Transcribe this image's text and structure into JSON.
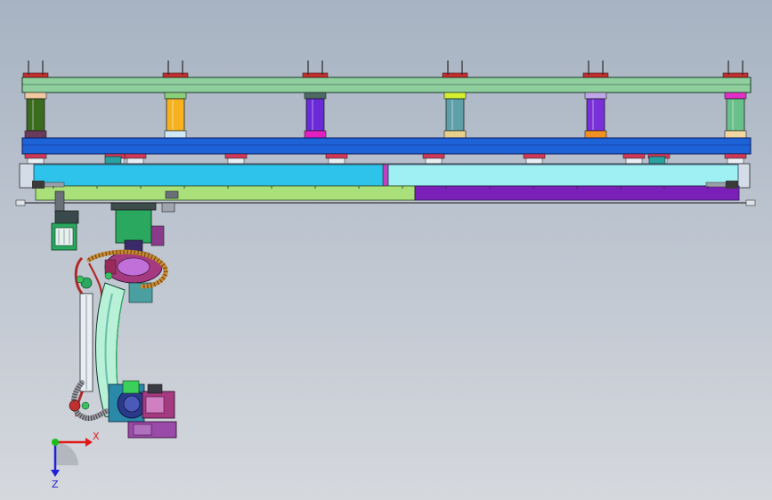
{
  "viewport": {
    "background_top": "#a7b3c2",
    "background_bottom": "#d5d8dd"
  },
  "model": {
    "gantry": {
      "top_beam_color": "#8fcf9e",
      "main_beam_color": "#1e62d8",
      "lower_left_rail_color": "#2ec3ea",
      "lower_right_rail_color": "#9ef0f2",
      "carriage_left_color": "#a9e07a",
      "carriage_right_color": "#7a1fb8",
      "posts": [
        {
          "column_color": "#3b6b1f",
          "cap_top": "#f2c9a0",
          "cap_bottom": "#6a3a5a"
        },
        {
          "column_color": "#f5b21e",
          "cap_top": "#8ad07a",
          "cap_bottom": "#cfe8f5"
        },
        {
          "column_color": "#6a2ad8",
          "cap_top": "#4d6a66",
          "cap_bottom": "#e020c0"
        },
        {
          "column_color": "#5fa0a8",
          "cap_top": "#d6f030",
          "cap_bottom": "#e8d08a"
        },
        {
          "column_color": "#7a30d8",
          "cap_top": "#c0a8e8",
          "cap_bottom": "#f09020"
        },
        {
          "column_color": "#6ac08a",
          "cap_top": "#e030c8",
          "cap_bottom": "#f2d8a0"
        }
      ]
    },
    "robot": {
      "base_color": "#2aa860",
      "arm_color": "#b8f0d8",
      "motor_color": "#a63a80",
      "hose_color": "#c68a30"
    }
  },
  "triad": {
    "x_label": "X",
    "z_label": "Z",
    "x_color": "#e01818",
    "y_color": "#18c018",
    "z_color": "#2020d8"
  }
}
